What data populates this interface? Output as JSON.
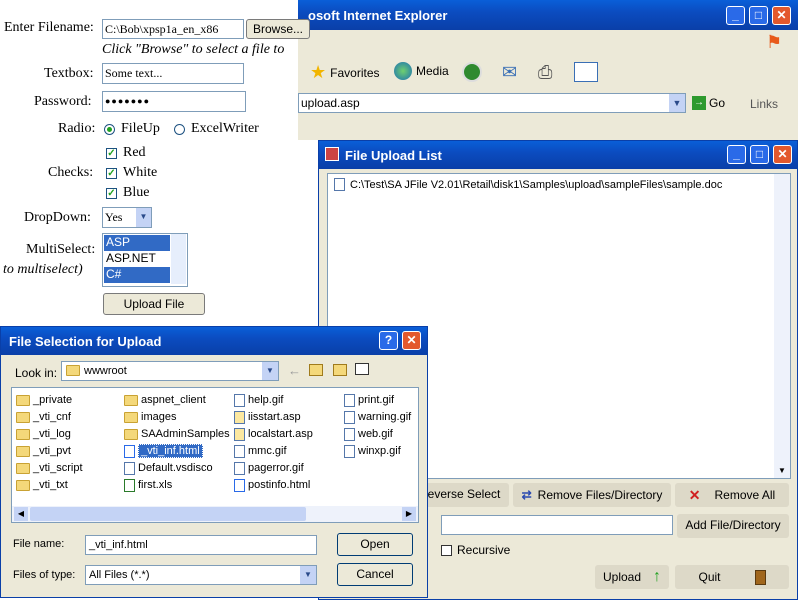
{
  "ie": {
    "title": "osoft Internet Explorer",
    "address": "upload.asp",
    "go": "Go",
    "links": "Links",
    "favorites": "Favorites",
    "media": "Media"
  },
  "form": {
    "filename_label": "Enter Filename:",
    "filename_value": "C:\\Bob\\xpsp1a_en_x86",
    "browse": "Browse...",
    "hint": "Click \"Browse\" to select a file to",
    "textbox_label": "Textbox:",
    "textbox_value": "Some text...",
    "password_label": "Password:",
    "password_value": "●●●●●●●",
    "radio_label": "Radio:",
    "radio1": "FileUp",
    "radio2": "ExcelWriter",
    "checks_label": "Checks:",
    "check1": "Red",
    "check2": "White",
    "check3": "Blue",
    "dropdown_label": "DropDown:",
    "dropdown_value": "Yes",
    "multiselect_label": "MultiSelect:",
    "multiselect_hint": "to multiselect)",
    "multiselect_options": [
      "ASP",
      "ASP.NET",
      "C#"
    ],
    "upload": "Upload File"
  },
  "uploadlist": {
    "title": "File Upload List",
    "entry": "C:\\Test\\SA JFile V2.01\\Retail\\disk1\\Samples\\upload\\sampleFiles\\sample.doc",
    "reverse": "everse Select",
    "remove": "Remove Files/Directory",
    "remove_all": "Remove All",
    "add": "Add File/Directory",
    "recursive": "Recursive",
    "upload": "Upload",
    "quit": "Quit"
  },
  "dialog": {
    "title": "File Selection for Upload",
    "lookin_label": "Look in:",
    "lookin_value": "wwwroot",
    "col1": [
      "_private",
      "_vti_cnf",
      "_vti_log",
      "_vti_pvt",
      "_vti_script",
      "_vti_txt"
    ],
    "col2": [
      "aspnet_client",
      "images",
      "SAAdminSamples",
      "_vti_inf.html",
      "Default.vsdisco",
      "first.xls"
    ],
    "col3": [
      "help.gif",
      "iisstart.asp",
      "localstart.asp",
      "mmc.gif",
      "pagerror.gif",
      "postinfo.html"
    ],
    "col4": [
      "print.gif",
      "warning.gif",
      "web.gif",
      "winxp.gif"
    ],
    "filename_label": "File name:",
    "filename_value": "_vti_inf.html",
    "filetype_label": "Files of type:",
    "filetype_value": "All Files (*.*)",
    "open": "Open",
    "cancel": "Cancel"
  },
  "colors": {
    "xp_blue": "#0b4cc0",
    "dialog_bg": "#ece9d8",
    "selection": "#316ac5"
  }
}
